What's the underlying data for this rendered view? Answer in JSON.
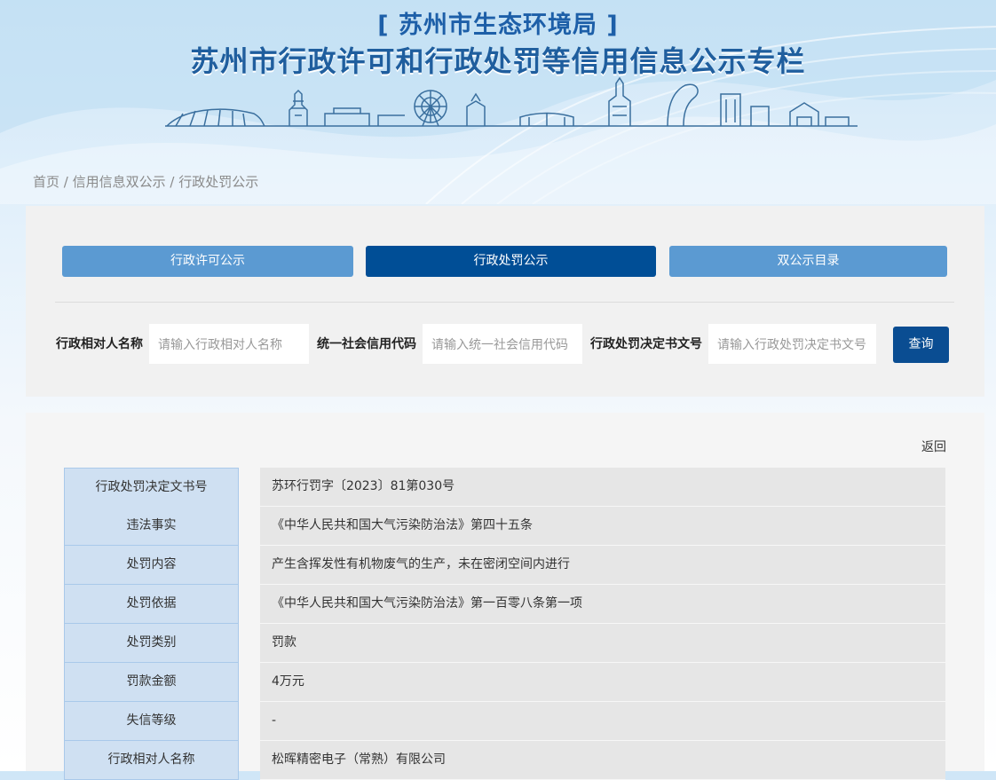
{
  "header": {
    "agency": "[ 苏州市生态环境局 ]",
    "title": "苏州市行政许可和行政处罚等信用信息公示专栏"
  },
  "breadcrumb": {
    "home": "首页",
    "sep": " / ",
    "section": "信用信息双公示",
    "current": "行政处罚公示"
  },
  "tabs": [
    {
      "label": "行政许可公示",
      "active": false
    },
    {
      "label": "行政处罚公示",
      "active": true
    },
    {
      "label": "双公示目录",
      "active": false
    }
  ],
  "search": {
    "name_label": "行政相对人名称",
    "name_placeholder": "请输入行政相对人名称",
    "code_label": "统一社会信用代码",
    "code_placeholder": "请输入统一社会信用代码",
    "doc_label": "行政处罚决定书文号",
    "doc_placeholder": "请输入行政处罚决定书文号",
    "button": "查询"
  },
  "back_label": "返回",
  "details": [
    {
      "key": "行政处罚决定文书号",
      "value": "苏环行罚字〔2023〕81第030号"
    },
    {
      "key": "违法事实",
      "value": "《中华人民共和国大气污染防治法》第四十五条"
    },
    {
      "key": "处罚内容",
      "value": "产生含挥发性有机物废气的生产，未在密闭空间内进行"
    },
    {
      "key": "处罚依据",
      "value": "《中华人民共和国大气污染防治法》第一百零八条第一项"
    },
    {
      "key": "处罚类别",
      "value": "罚款"
    },
    {
      "key": "罚款金额",
      "value": "4万元"
    },
    {
      "key": "失信等级",
      "value": "-"
    },
    {
      "key": "行政相对人名称",
      "value": "松晖精密电子（常熟）有限公司"
    }
  ],
  "colors": {
    "tab_light": "#5b9ad2",
    "tab_dark": "#004e96",
    "title_blue": "#1f5e9e",
    "key_cell": "#cfe0f2"
  }
}
